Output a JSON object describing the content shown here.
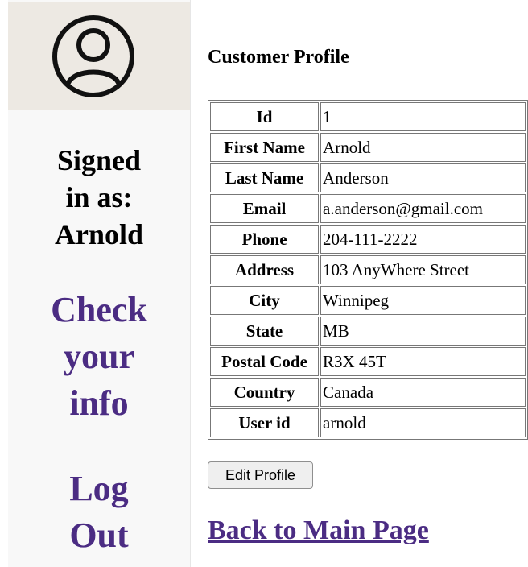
{
  "sidebar": {
    "avatar_icon": "user-circle-icon",
    "signed_in": [
      "Signed",
      "in as:",
      "Arnold"
    ],
    "check_info": [
      "Check",
      "your",
      "info"
    ],
    "logout": [
      "Log",
      "Out"
    ]
  },
  "main": {
    "title": "Customer Profile",
    "rows": [
      {
        "label": "Id",
        "value": "1"
      },
      {
        "label": "First Name",
        "value": "Arnold"
      },
      {
        "label": "Last Name",
        "value": "Anderson"
      },
      {
        "label": "Email",
        "value": "a.anderson@gmail.com"
      },
      {
        "label": "Phone",
        "value": "204-111-2222"
      },
      {
        "label": "Address",
        "value": "103 AnyWhere Street"
      },
      {
        "label": "City",
        "value": "Winnipeg"
      },
      {
        "label": "State",
        "value": "MB"
      },
      {
        "label": "Postal Code",
        "value": "R3X 45T"
      },
      {
        "label": "Country",
        "value": "Canada"
      },
      {
        "label": "User id",
        "value": "arnold"
      }
    ],
    "edit_button": "Edit Profile",
    "back_link": "Back to Main Page"
  },
  "colors": {
    "link": "#4b2c83",
    "sidebar_bg": "#f8f8f8",
    "avatar_bg": "#ede9e3"
  }
}
